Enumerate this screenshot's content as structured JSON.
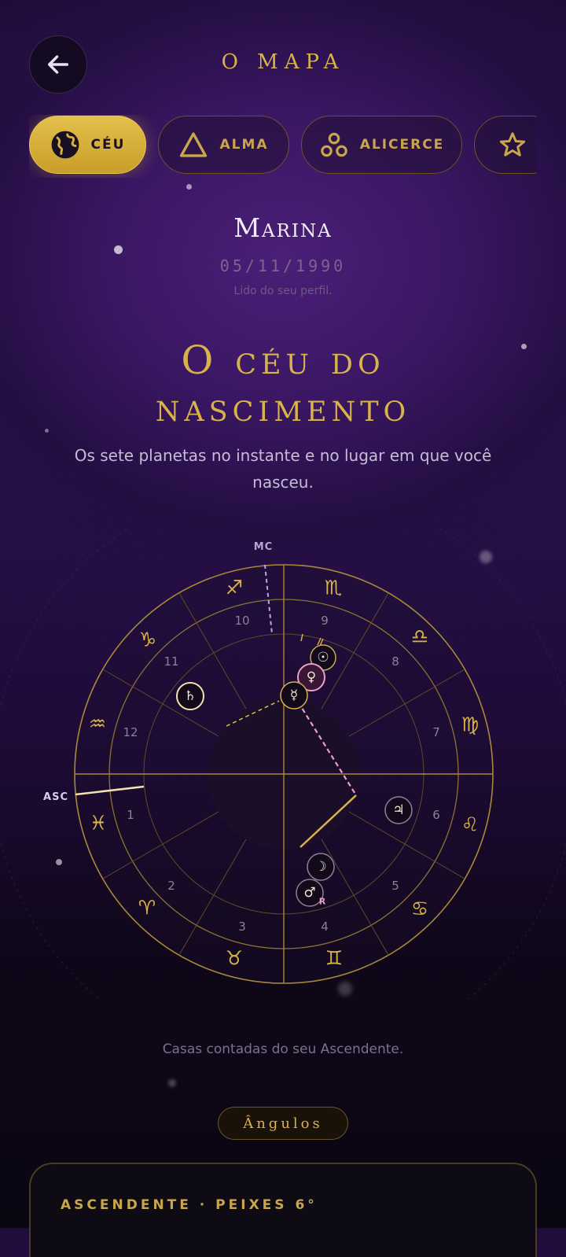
{
  "header": {
    "title": "O MAPA",
    "back_icon": "arrow-left-icon"
  },
  "tabs": [
    {
      "label": "CÉU",
      "icon": "globe-icon",
      "active": true
    },
    {
      "label": "ALMA",
      "icon": "triangle-icon",
      "active": false
    },
    {
      "label": "ALICERCE",
      "icon": "circles-icon",
      "active": false
    },
    {
      "label": "",
      "icon": "star-icon",
      "active": false
    }
  ],
  "profile": {
    "name": "Marina",
    "date": "05/11/1990",
    "note": "Lido do seu perfil."
  },
  "section": {
    "title": "O céu do nascimento",
    "subtitle": "Os sete planetas no instante e no lugar em que você nasceu."
  },
  "chart": {
    "label_mc": "MC",
    "label_asc": "ASC",
    "houses": [
      "1",
      "2",
      "3",
      "4",
      "5",
      "6",
      "7",
      "8",
      "9",
      "10",
      "11",
      "12"
    ],
    "signs": [
      "♓",
      "♈",
      "♉",
      "♊",
      "♋",
      "♌",
      "♍",
      "♎",
      "♏",
      "♐",
      "♑",
      "♒"
    ],
    "planets": [
      {
        "name": "sun",
        "glyph": "☉"
      },
      {
        "name": "venus",
        "glyph": "♀"
      },
      {
        "name": "mercury",
        "glyph": "☿"
      },
      {
        "name": "saturn",
        "glyph": "♄"
      },
      {
        "name": "jupiter",
        "glyph": "♃"
      },
      {
        "name": "moon",
        "glyph": "☽"
      },
      {
        "name": "mars",
        "glyph": "♂",
        "retro_label": "R"
      }
    ],
    "colors": {
      "gold": "#d8b24a",
      "mc_line": "#b48be0",
      "aspect_pink": "#e8a0c8"
    }
  },
  "footer": {
    "houses_note": "Casas contadas do seu Ascendente.",
    "angles_label": "Ângulos",
    "card_title": "ASCENDENTE · PEIXES 6°"
  }
}
